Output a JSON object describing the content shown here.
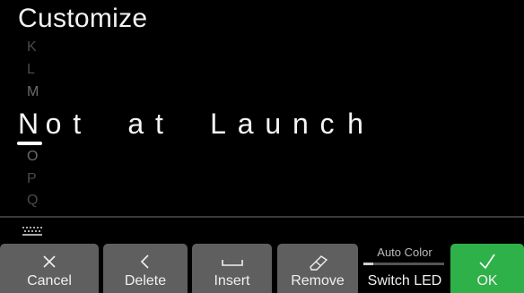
{
  "header": {
    "title": "Customize"
  },
  "picker": {
    "above": [
      "K",
      "L",
      "M"
    ],
    "current": "N",
    "below": [
      "O",
      "P",
      "Q"
    ]
  },
  "name_editor": {
    "chars": [
      "N",
      "o",
      "t",
      " ",
      "a",
      "t",
      " ",
      "L",
      "a",
      "u",
      "n",
      "c",
      "h"
    ],
    "cursor_index": 0
  },
  "softkeys": {
    "cancel": {
      "label": "Cancel",
      "icon": "x-icon"
    },
    "delete": {
      "label": "Delete",
      "icon": "chevron-left-icon"
    },
    "insert": {
      "label": "Insert",
      "icon": "space-bracket-icon"
    },
    "remove": {
      "label": "Remove",
      "icon": "eraser-icon"
    },
    "switch_led": {
      "label": "Switch LED",
      "value": "Auto Color",
      "level": 0.12
    },
    "ok": {
      "label": "OK",
      "icon": "checkmark-icon"
    }
  },
  "colors": {
    "background": "#000000",
    "softkey": "#5f5f5f",
    "ok": "#2fb14a",
    "dim_letter": "#4a4a4a"
  }
}
